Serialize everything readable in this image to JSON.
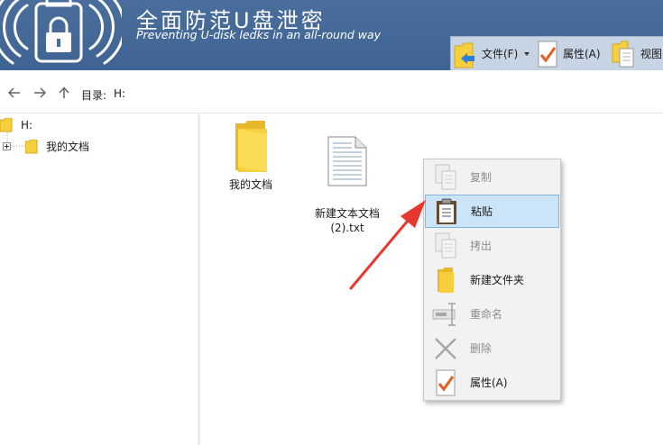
{
  "app": {
    "title": "全面防范U盘泄密",
    "subtitle": "Preventing U-disk ledks in an all-round way"
  },
  "toolbar": {
    "file_label": "文件(F)",
    "properties_label": "属性(A)",
    "view_label": "视图"
  },
  "nav": {
    "path_label": "目录:",
    "path_value": "H:"
  },
  "tree": {
    "root_label": "H:",
    "child_label": "我的文档"
  },
  "files": [
    {
      "name": "我的文档",
      "icon": "folder-icon"
    },
    {
      "name": "新建文本文档\n(2).txt",
      "icon": "text-file-icon"
    }
  ],
  "context_menu": {
    "items": [
      {
        "label": "复制",
        "icon": "copy-icon",
        "enabled": false
      },
      {
        "label": "粘贴",
        "icon": "paste-icon",
        "enabled": true,
        "highlighted": true
      },
      {
        "label": "拷出",
        "icon": "export-icon",
        "enabled": false
      },
      {
        "label": "新建文件夹",
        "icon": "new-folder-icon",
        "enabled": true
      },
      {
        "label": "重命名",
        "icon": "rename-icon",
        "enabled": false
      },
      {
        "label": "删除",
        "icon": "delete-icon",
        "enabled": false
      },
      {
        "label": "属性(A)",
        "icon": "properties-icon",
        "enabled": true
      }
    ]
  },
  "colors": {
    "header_bg": "#4a6e9c",
    "toolbar_bg": "#c6d4e4",
    "menu_highlight": "#cce4f7",
    "annotation_arrow": "#e8372e",
    "folder_yellow": "#f6cf3e"
  }
}
